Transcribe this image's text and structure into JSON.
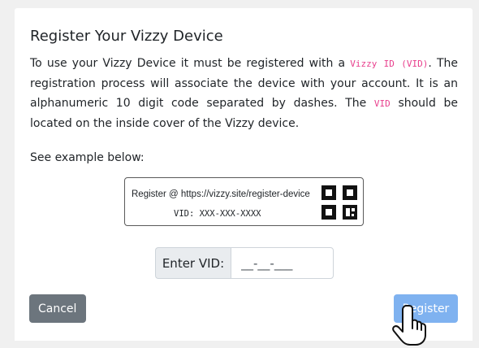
{
  "modal": {
    "title": "Register Your Vizzy Device",
    "description": {
      "part1": "To use your Vizzy Device it must be registered with a ",
      "code1": "Vizzy ID (VID)",
      "part2": ". The registration process will associate the device with your account. It is an alphanumeric 10 digit code separated by dashes. The ",
      "code2": "VID",
      "part3": " should be located on the inside cover of the Vizzy device."
    },
    "see_example": "See example below:",
    "example": {
      "line1": "Register @ https://vizzy.site/register-device",
      "line2": "VID: XXX-XXX-XXXX",
      "icon": "qr-code-icon"
    },
    "vid_field": {
      "label": "Enter VID:",
      "placeholder": "__-__-___"
    },
    "buttons": {
      "cancel": "Cancel",
      "register": "Register"
    },
    "colors": {
      "code_text": "#e83e8c",
      "cancel_button": "#6c757d",
      "register_button": "#7fb2f0"
    },
    "cursor": "hand-pointer-icon"
  }
}
